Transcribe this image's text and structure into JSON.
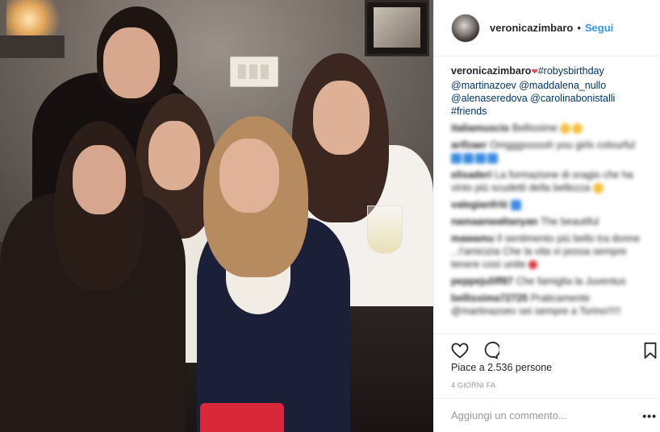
{
  "header": {
    "username": "veronicazimbaro",
    "separator": "•",
    "follow_label": "Segui"
  },
  "caption": {
    "username": "veronicazimbaro",
    "heart": "❤",
    "hashtag": "#robysbirthday",
    "mentions_line1": "@martinazoev @maddalena_nullo",
    "mentions_line2": "@alenaseredova @carolinabonistalli",
    "hashtag2": "#friends"
  },
  "comments": [
    {
      "user": "italiamuscio",
      "text": "Bellissime"
    },
    {
      "user": "arifzaer",
      "text": "Omgggsssssh you girls colourful"
    },
    {
      "user": "elisaderi",
      "text": "La formazione di oragio che ha vinto più scudetti della bellezza"
    },
    {
      "user": "valegianfriti",
      "text": ""
    },
    {
      "user": "namaanwaltanyan",
      "text": "The beautiful"
    },
    {
      "user": "mawamu",
      "text": "Il sentimento più bello tra donne ...l'amicizia Che la vita vi possa sempre tenere così unite"
    },
    {
      "user": "peppejuliff87",
      "text": "Che famiglia la Juventus"
    },
    {
      "user": "bellissima72725",
      "text": "Praticamente @martinazoev sei sempre a Torino!!!!!"
    }
  ],
  "likes_text": "Piace a 2.536 persone",
  "time_ago": "4 GIORNI FA",
  "add_comment_placeholder": "Aggiungi un commento...",
  "more_label": "•••",
  "icons": {
    "like": "heart-outline-icon",
    "comment": "speech-bubble-icon",
    "save": "bookmark-icon"
  },
  "colors": {
    "follow": "#3897f0",
    "tag": "#003569",
    "muted": "#999999",
    "text": "#262626"
  }
}
